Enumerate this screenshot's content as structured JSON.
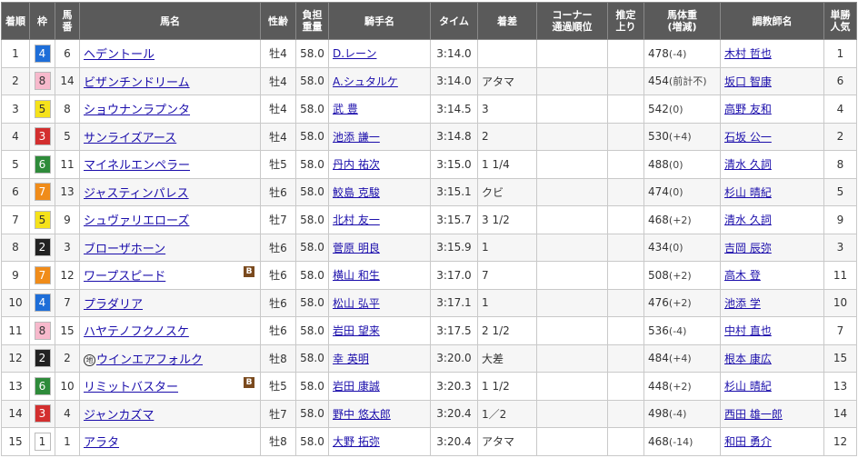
{
  "headers": [
    "着順",
    "枠",
    "馬番",
    "馬名",
    "性齢",
    "負担重量",
    "騎手名",
    "タイム",
    "着差",
    "コーナー通過順位",
    "推定上り",
    "馬体重(増減)",
    "調教師名",
    "単勝人気"
  ],
  "header_lines": {
    "futan": [
      "負担",
      "重量"
    ],
    "corner": [
      "コーナー",
      "通過順位"
    ],
    "agari": [
      "推定",
      "上り"
    ],
    "weight": [
      "馬体重",
      "(増減)"
    ],
    "tansho": [
      "単勝",
      "人気"
    ],
    "umaban": [
      "馬",
      "番"
    ]
  },
  "frame_colors": {
    "1": {
      "bg": "#ffffff",
      "fg": "#333333"
    },
    "2": {
      "bg": "#222222",
      "fg": "#ffffff"
    },
    "3": {
      "bg": "#d32f2f",
      "fg": "#ffffff"
    },
    "4": {
      "bg": "#1e6ed8",
      "fg": "#ffffff"
    },
    "5": {
      "bg": "#f5e21b",
      "fg": "#333333"
    },
    "6": {
      "bg": "#2e8b3a",
      "fg": "#ffffff"
    },
    "7": {
      "bg": "#f08c1a",
      "fg": "#ffffff"
    },
    "8": {
      "bg": "#f7b9cc",
      "fg": "#333333"
    }
  },
  "rows": [
    {
      "rank": "1",
      "waku": "4",
      "umaban": "6",
      "horse": "ヘデントール",
      "maru": "",
      "blinker": "",
      "sexage": "牡4",
      "weight_carried": "58.0",
      "jockey": "D.レーン",
      "time": "3:14.0",
      "margin": "",
      "corner": "",
      "agari": "",
      "bodyweight": "478",
      "bw_change": "(-4)",
      "trainer": "木村 哲也",
      "pop": "1"
    },
    {
      "rank": "2",
      "waku": "8",
      "umaban": "14",
      "horse": "ビザンチンドリーム",
      "maru": "",
      "blinker": "",
      "sexage": "牡4",
      "weight_carried": "58.0",
      "jockey": "A.シュタルケ",
      "time": "3:14.0",
      "margin": "アタマ",
      "corner": "",
      "agari": "",
      "bodyweight": "454",
      "bw_change": "(前計不)",
      "trainer": "坂口 智康",
      "pop": "6"
    },
    {
      "rank": "3",
      "waku": "5",
      "umaban": "8",
      "horse": "ショウナンラプンタ",
      "maru": "",
      "blinker": "",
      "sexage": "牡4",
      "weight_carried": "58.0",
      "jockey": "武 豊",
      "time": "3:14.5",
      "margin": "3",
      "corner": "",
      "agari": "",
      "bodyweight": "542",
      "bw_change": "(0)",
      "trainer": "高野 友和",
      "pop": "4"
    },
    {
      "rank": "4",
      "waku": "3",
      "umaban": "5",
      "horse": "サンライズアース",
      "maru": "",
      "blinker": "",
      "sexage": "牡4",
      "weight_carried": "58.0",
      "jockey": "池添 謙一",
      "time": "3:14.8",
      "margin": "2",
      "corner": "",
      "agari": "",
      "bodyweight": "530",
      "bw_change": "(+4)",
      "trainer": "石坂 公一",
      "pop": "2"
    },
    {
      "rank": "5",
      "waku": "6",
      "umaban": "11",
      "horse": "マイネルエンペラー",
      "maru": "",
      "blinker": "",
      "sexage": "牡5",
      "weight_carried": "58.0",
      "jockey": "丹内 祐次",
      "time": "3:15.0",
      "margin": "1 1/4",
      "corner": "",
      "agari": "",
      "bodyweight": "488",
      "bw_change": "(0)",
      "trainer": "清水 久詞",
      "pop": "8"
    },
    {
      "rank": "6",
      "waku": "7",
      "umaban": "13",
      "horse": "ジャスティンパレス",
      "maru": "",
      "blinker": "",
      "sexage": "牡6",
      "weight_carried": "58.0",
      "jockey": "鮫島 克駿",
      "time": "3:15.1",
      "margin": "クビ",
      "corner": "",
      "agari": "",
      "bodyweight": "474",
      "bw_change": "(0)",
      "trainer": "杉山 晴紀",
      "pop": "5"
    },
    {
      "rank": "7",
      "waku": "5",
      "umaban": "9",
      "horse": "シュヴァリエローズ",
      "maru": "",
      "blinker": "",
      "sexage": "牡7",
      "weight_carried": "58.0",
      "jockey": "北村 友一",
      "time": "3:15.7",
      "margin": "3 1/2",
      "corner": "",
      "agari": "",
      "bodyweight": "468",
      "bw_change": "(+2)",
      "trainer": "清水 久詞",
      "pop": "9"
    },
    {
      "rank": "8",
      "waku": "2",
      "umaban": "3",
      "horse": "ブローザホーン",
      "maru": "",
      "blinker": "",
      "sexage": "牡6",
      "weight_carried": "58.0",
      "jockey": "菅原 明良",
      "time": "3:15.9",
      "margin": "1",
      "corner": "",
      "agari": "",
      "bodyweight": "434",
      "bw_change": "(0)",
      "trainer": "吉岡 辰弥",
      "pop": "3"
    },
    {
      "rank": "9",
      "waku": "7",
      "umaban": "12",
      "horse": "ワープスピード",
      "maru": "",
      "blinker": "B",
      "sexage": "牡6",
      "weight_carried": "58.0",
      "jockey": "横山 和生",
      "time": "3:17.0",
      "margin": "7",
      "corner": "",
      "agari": "",
      "bodyweight": "508",
      "bw_change": "(+2)",
      "trainer": "高木 登",
      "pop": "11"
    },
    {
      "rank": "10",
      "waku": "4",
      "umaban": "7",
      "horse": "プラダリア",
      "maru": "",
      "blinker": "",
      "sexage": "牡6",
      "weight_carried": "58.0",
      "jockey": "松山 弘平",
      "time": "3:17.1",
      "margin": "1",
      "corner": "",
      "agari": "",
      "bodyweight": "476",
      "bw_change": "(+2)",
      "trainer": "池添 学",
      "pop": "10"
    },
    {
      "rank": "11",
      "waku": "8",
      "umaban": "15",
      "horse": "ハヤテノフクノスケ",
      "maru": "",
      "blinker": "",
      "sexage": "牡6",
      "weight_carried": "58.0",
      "jockey": "岩田 望来",
      "time": "3:17.5",
      "margin": "2 1/2",
      "corner": "",
      "agari": "",
      "bodyweight": "536",
      "bw_change": "(-4)",
      "trainer": "中村 直也",
      "pop": "7"
    },
    {
      "rank": "12",
      "waku": "2",
      "umaban": "2",
      "horse": "ウインエアフォルク",
      "maru": "地",
      "blinker": "",
      "sexage": "牡8",
      "weight_carried": "58.0",
      "jockey": "幸 英明",
      "time": "3:20.0",
      "margin": "大差",
      "corner": "",
      "agari": "",
      "bodyweight": "484",
      "bw_change": "(+4)",
      "trainer": "根本 康広",
      "pop": "15"
    },
    {
      "rank": "13",
      "waku": "6",
      "umaban": "10",
      "horse": "リミットバスター",
      "maru": "",
      "blinker": "B",
      "sexage": "牡5",
      "weight_carried": "58.0",
      "jockey": "岩田 康誠",
      "time": "3:20.3",
      "margin": "1 1/2",
      "corner": "",
      "agari": "",
      "bodyweight": "448",
      "bw_change": "(+2)",
      "trainer": "杉山 晴紀",
      "pop": "13"
    },
    {
      "rank": "14",
      "waku": "3",
      "umaban": "4",
      "horse": "ジャンカズマ",
      "maru": "",
      "blinker": "",
      "sexage": "牡7",
      "weight_carried": "58.0",
      "jockey": "野中 悠太郎",
      "time": "3:20.4",
      "margin": "1／2",
      "corner": "",
      "agari": "",
      "bodyweight": "498",
      "bw_change": "(-4)",
      "trainer": "西田 雄一郎",
      "pop": "14"
    },
    {
      "rank": "15",
      "waku": "1",
      "umaban": "1",
      "horse": "アラタ",
      "maru": "",
      "blinker": "",
      "sexage": "牡8",
      "weight_carried": "58.0",
      "jockey": "大野 拓弥",
      "time": "3:20.4",
      "margin": "アタマ",
      "corner": "",
      "agari": "",
      "bodyweight": "468",
      "bw_change": "(-14)",
      "trainer": "和田 勇介",
      "pop": "12"
    }
  ]
}
